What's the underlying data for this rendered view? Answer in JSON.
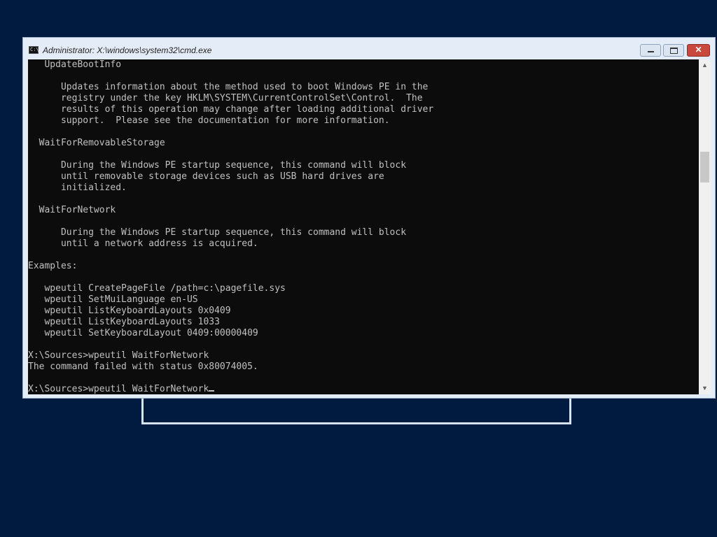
{
  "window": {
    "title": "Administrator: X:\\windows\\system32\\cmd.exe",
    "icon_text": "C:\\",
    "buttons": {
      "minimize": "minimize-icon",
      "maximize": "maximize-icon",
      "close": "close-icon"
    }
  },
  "console": {
    "lines": [
      "   UpdateBootInfo",
      "",
      "      Updates information about the method used to boot Windows PE in the",
      "      registry under the key HKLM\\SYSTEM\\CurrentControlSet\\Control.  The",
      "      results of this operation may change after loading additional driver",
      "      support.  Please see the documentation for more information.",
      "",
      "  WaitForRemovableStorage",
      "",
      "      During the Windows PE startup sequence, this command will block",
      "      until removable storage devices such as USB hard drives are",
      "      initialized.",
      "",
      "  WaitForNetwork",
      "",
      "      During the Windows PE startup sequence, this command will block",
      "      until a network address is acquired.",
      "",
      "Examples:",
      "",
      "   wpeutil CreatePageFile /path=c:\\pagefile.sys",
      "   wpeutil SetMuiLanguage en-US",
      "   wpeutil ListKeyboardLayouts 0x0409",
      "   wpeutil ListKeyboardLayouts 1033",
      "   wpeutil SetKeyboardLayout 0409:00000409",
      "",
      "X:\\Sources>wpeutil WaitForNetwork",
      "The command failed with status 0x80074005.",
      ""
    ],
    "prompt_line": "X:\\Sources>wpeutil WaitForNetwork"
  },
  "scrollbar": {
    "up_icon": "chevron-up-icon",
    "down_icon": "chevron-down-icon",
    "up_glyph": "▲",
    "down_glyph": "▼"
  },
  "close_glyph": "✕",
  "colors": {
    "desktop": "#011a3f",
    "console_bg": "#0c0c0c",
    "console_fg": "#c0c0c0",
    "close_button": "#c9483c"
  }
}
